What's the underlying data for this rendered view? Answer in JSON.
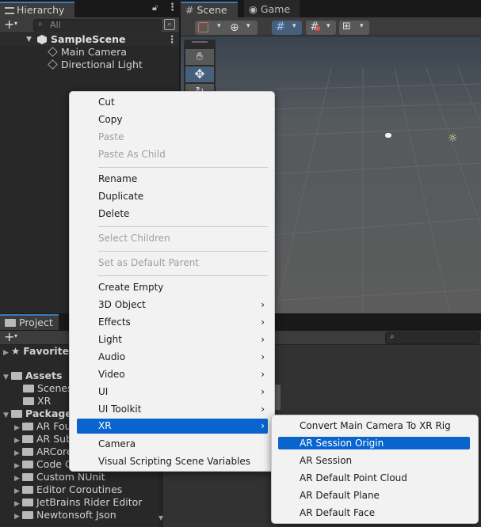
{
  "hierarchy": {
    "tab_label": "Hierarchy",
    "search_placeholder": "All",
    "items": [
      {
        "label": "SampleScene"
      },
      {
        "label": "Main Camera"
      },
      {
        "label": "Directional Light"
      }
    ]
  },
  "scene_view": {
    "tabs": [
      {
        "label": "Scene"
      },
      {
        "label": "Game"
      }
    ]
  },
  "project": {
    "tab_label": "Project",
    "tree": [
      {
        "label": "Favorites"
      },
      {
        "label": "Assets"
      },
      {
        "label": "Scenes"
      },
      {
        "label": "XR"
      },
      {
        "label": "Packages"
      },
      {
        "label": "AR Fou"
      },
      {
        "label": "AR Sub"
      },
      {
        "label": "ARCore"
      },
      {
        "label": "Code C"
      },
      {
        "label": "Custom NUnit"
      },
      {
        "label": "Editor Coroutines"
      },
      {
        "label": "JetBrains Rider Editor"
      },
      {
        "label": "Newtonsoft Json"
      }
    ]
  },
  "context_menu": {
    "items": [
      {
        "label": "Cut"
      },
      {
        "label": "Copy"
      },
      {
        "label": "Paste"
      },
      {
        "label": "Paste As Child"
      },
      {
        "label": "Rename"
      },
      {
        "label": "Duplicate"
      },
      {
        "label": "Delete"
      },
      {
        "label": "Select Children"
      },
      {
        "label": "Set as Default Parent"
      },
      {
        "label": "Create Empty"
      },
      {
        "label": "3D Object"
      },
      {
        "label": "Effects"
      },
      {
        "label": "Light"
      },
      {
        "label": "Audio"
      },
      {
        "label": "Video"
      },
      {
        "label": "UI"
      },
      {
        "label": "UI Toolkit"
      },
      {
        "label": "XR"
      },
      {
        "label": "Camera"
      },
      {
        "label": "Visual Scripting Scene Variables"
      }
    ],
    "submenu_arrow": "›"
  },
  "xr_submenu": {
    "items": [
      {
        "label": "Convert Main Camera To XR Rig"
      },
      {
        "label": "AR Session Origin"
      },
      {
        "label": "AR Session"
      },
      {
        "label": "AR Default Point Cloud"
      },
      {
        "label": "AR Default Plane"
      },
      {
        "label": "AR Default Face"
      }
    ]
  },
  "icons": {
    "hand_tool": "hand-icon",
    "move_tool": "move-icon",
    "lock": "lock-icon",
    "kebab": "more-vert-icon"
  },
  "colors": {
    "selection_blue": "#0a64ce",
    "active_tab_accent": "#3a79bb"
  }
}
